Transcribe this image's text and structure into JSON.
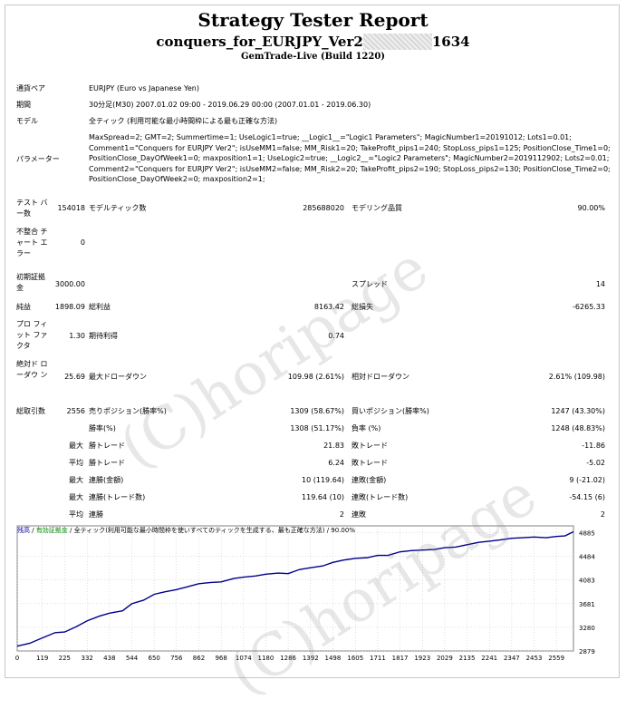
{
  "header": {
    "title": "Strategy Tester Report",
    "ea_name_prefix": "conquers_for_EURJPY_Ver2",
    "ea_name_suffix": "1634",
    "server": "GemTrade-Live (Build 1220)"
  },
  "info": {
    "pair_label": "通貨ペア",
    "pair_value": "EURJPY (Euro vs Japanese Yen)",
    "period_label": "期間",
    "period_value": "30分足(M30) 2007.01.02 09:00 - 2019.06.29 00:00 (2007.01.01 - 2019.06.30)",
    "model_label": "モデル",
    "model_value": "全ティック (利用可能な最小時間枠による最も正確な方法)",
    "param_label": "パラメーター",
    "param_value": "MaxSpread=2; GMT=2; Summertime=1; UseLogic1=true; __Logic1__=\"Logic1 Parameters\"; MagicNumber1=20191012; Lots1=0.01; Comment1=\"Conquers for EURJPY Ver2\"; isUseMM1=false; MM_Risk1=20; TakeProfit_pips1=240; StopLoss_pips1=125; PositionClose_Time1=0; PositionClose_DayOfWeek1=0; maxposition1=1; UseLogic2=true; __Logic2__=\"Logic2 Parameters\"; MagicNumber2=2019112902; Lots2=0.01; Comment2=\"Conquers for EURJPY Ver2\"; isUseMM2=false; MM_Risk2=20; TakeProfit_pips2=190; StopLoss_pips2=130; PositionClose_Time2=0; PositionClose_DayOfWeek2=0; maxposition2=1;"
  },
  "stats": {
    "bars_label": "テスト バー数",
    "bars_value": "154018",
    "ticks_label": "モデルティック数",
    "ticks_value": "285688020",
    "quality_label": "モデリング品質",
    "quality_value": "90.00%",
    "mismatch_label": "不整合 チャート エラー",
    "mismatch_value": "0",
    "deposit_label": "初期証拠 金",
    "deposit_value": "3000.00",
    "spread_label": "スプレッド",
    "spread_value": "14",
    "net_label": "純益",
    "net_value": "1898.09",
    "gross_profit_label": "総利益",
    "gross_profit_value": "8163.42",
    "gross_loss_label": "総損失",
    "gross_loss_value": "-6265.33",
    "pf_label": "プロ フィット ファクタ",
    "pf_value": "1.30",
    "expected_label": "期待利得",
    "expected_value": "0.74",
    "abs_dd_label": "絶対ド ローダウ ン",
    "abs_dd_value": "25.69",
    "max_dd_label": "最大ドローダウン",
    "max_dd_value": "109.98 (2.61%)",
    "rel_dd_label": "相対ドローダウン",
    "rel_dd_value": "2.61% (109.98)",
    "trades_label": "総取引数",
    "trades_value": "2556",
    "short_label": "売りポジション(勝率%)",
    "short_value": "1309 (58.67%)",
    "long_label": "買いポジション(勝率%)",
    "long_value": "1247 (43.30%)",
    "win_label": "勝率(%)",
    "win_value": "1308 (51.17%)",
    "loss_label": "負率 (%)",
    "loss_value": "1248 (48.83%)",
    "max_word": "最大",
    "avg_word": "平均",
    "largest_win_label": "勝トレード",
    "largest_win_value": "21.83",
    "largest_loss_label": "敗トレード",
    "largest_loss_value": "-11.86",
    "avg_win_label": "勝トレード",
    "avg_win_value": "6.24",
    "avg_loss_label": "敗トレード",
    "avg_loss_value": "-5.02",
    "max_cons_win_label": "連勝(金額)",
    "max_cons_win_value": "10 (119.64)",
    "max_cons_loss_label": "連敗(金額)",
    "max_cons_loss_value": "9 (-21.02)",
    "max_cons_profit_label": "連勝(トレード数)",
    "max_cons_profit_value": "119.64 (10)",
    "max_cons_lossamt_label": "連敗(トレード数)",
    "max_cons_lossamt_value": "-54.15 (6)",
    "avg_cons_win_label": "連勝",
    "avg_cons_win_value": "2",
    "avg_cons_loss_label": "連敗",
    "avg_cons_loss_value": "2"
  },
  "legend": {
    "balance": "残高",
    "equity": "有効証拠金",
    "model_text": "全ティック(利用可能な最小時間枠を使いすべてのティックを生成する、最も正確な方法)",
    "quality": "90.00%"
  },
  "watermark": "(C)horipage",
  "colors": {
    "balance_line": "#00008b",
    "equity": "#008800",
    "grid": "#c0c0c0"
  },
  "chart_data": {
    "type": "line",
    "x_ticks": [
      0,
      119,
      225,
      332,
      438,
      544,
      650,
      756,
      862,
      968,
      1074,
      1180,
      1286,
      1392,
      1498,
      1605,
      1711,
      1817,
      1923,
      2029,
      2135,
      2241,
      2347,
      2453,
      2559
    ],
    "y_ticks": [
      2879,
      3280,
      3681,
      4083,
      4484,
      4885
    ],
    "xlim": [
      0,
      2640
    ],
    "ylim": [
      2879,
      5000
    ],
    "series": [
      {
        "name": "残高",
        "x": [
          0,
          60,
          119,
          180,
          225,
          280,
          332,
          390,
          438,
          500,
          544,
          600,
          650,
          700,
          756,
          800,
          862,
          920,
          968,
          1030,
          1074,
          1130,
          1180,
          1240,
          1286,
          1340,
          1392,
          1450,
          1498,
          1550,
          1605,
          1660,
          1711,
          1760,
          1817,
          1870,
          1923,
          1980,
          2029,
          2080,
          2135,
          2190,
          2241,
          2290,
          2347,
          2400,
          2453,
          2510,
          2559,
          2600,
          2640
        ],
        "values": [
          2960,
          3010,
          3100,
          3190,
          3200,
          3290,
          3390,
          3470,
          3520,
          3560,
          3680,
          3740,
          3840,
          3880,
          3920,
          3960,
          4020,
          4040,
          4050,
          4110,
          4130,
          4150,
          4180,
          4200,
          4190,
          4260,
          4290,
          4320,
          4380,
          4420,
          4450,
          4460,
          4500,
          4500,
          4560,
          4580,
          4590,
          4600,
          4630,
          4640,
          4680,
          4720,
          4740,
          4760,
          4790,
          4800,
          4810,
          4800,
          4820,
          4830,
          4900
        ]
      }
    ]
  }
}
